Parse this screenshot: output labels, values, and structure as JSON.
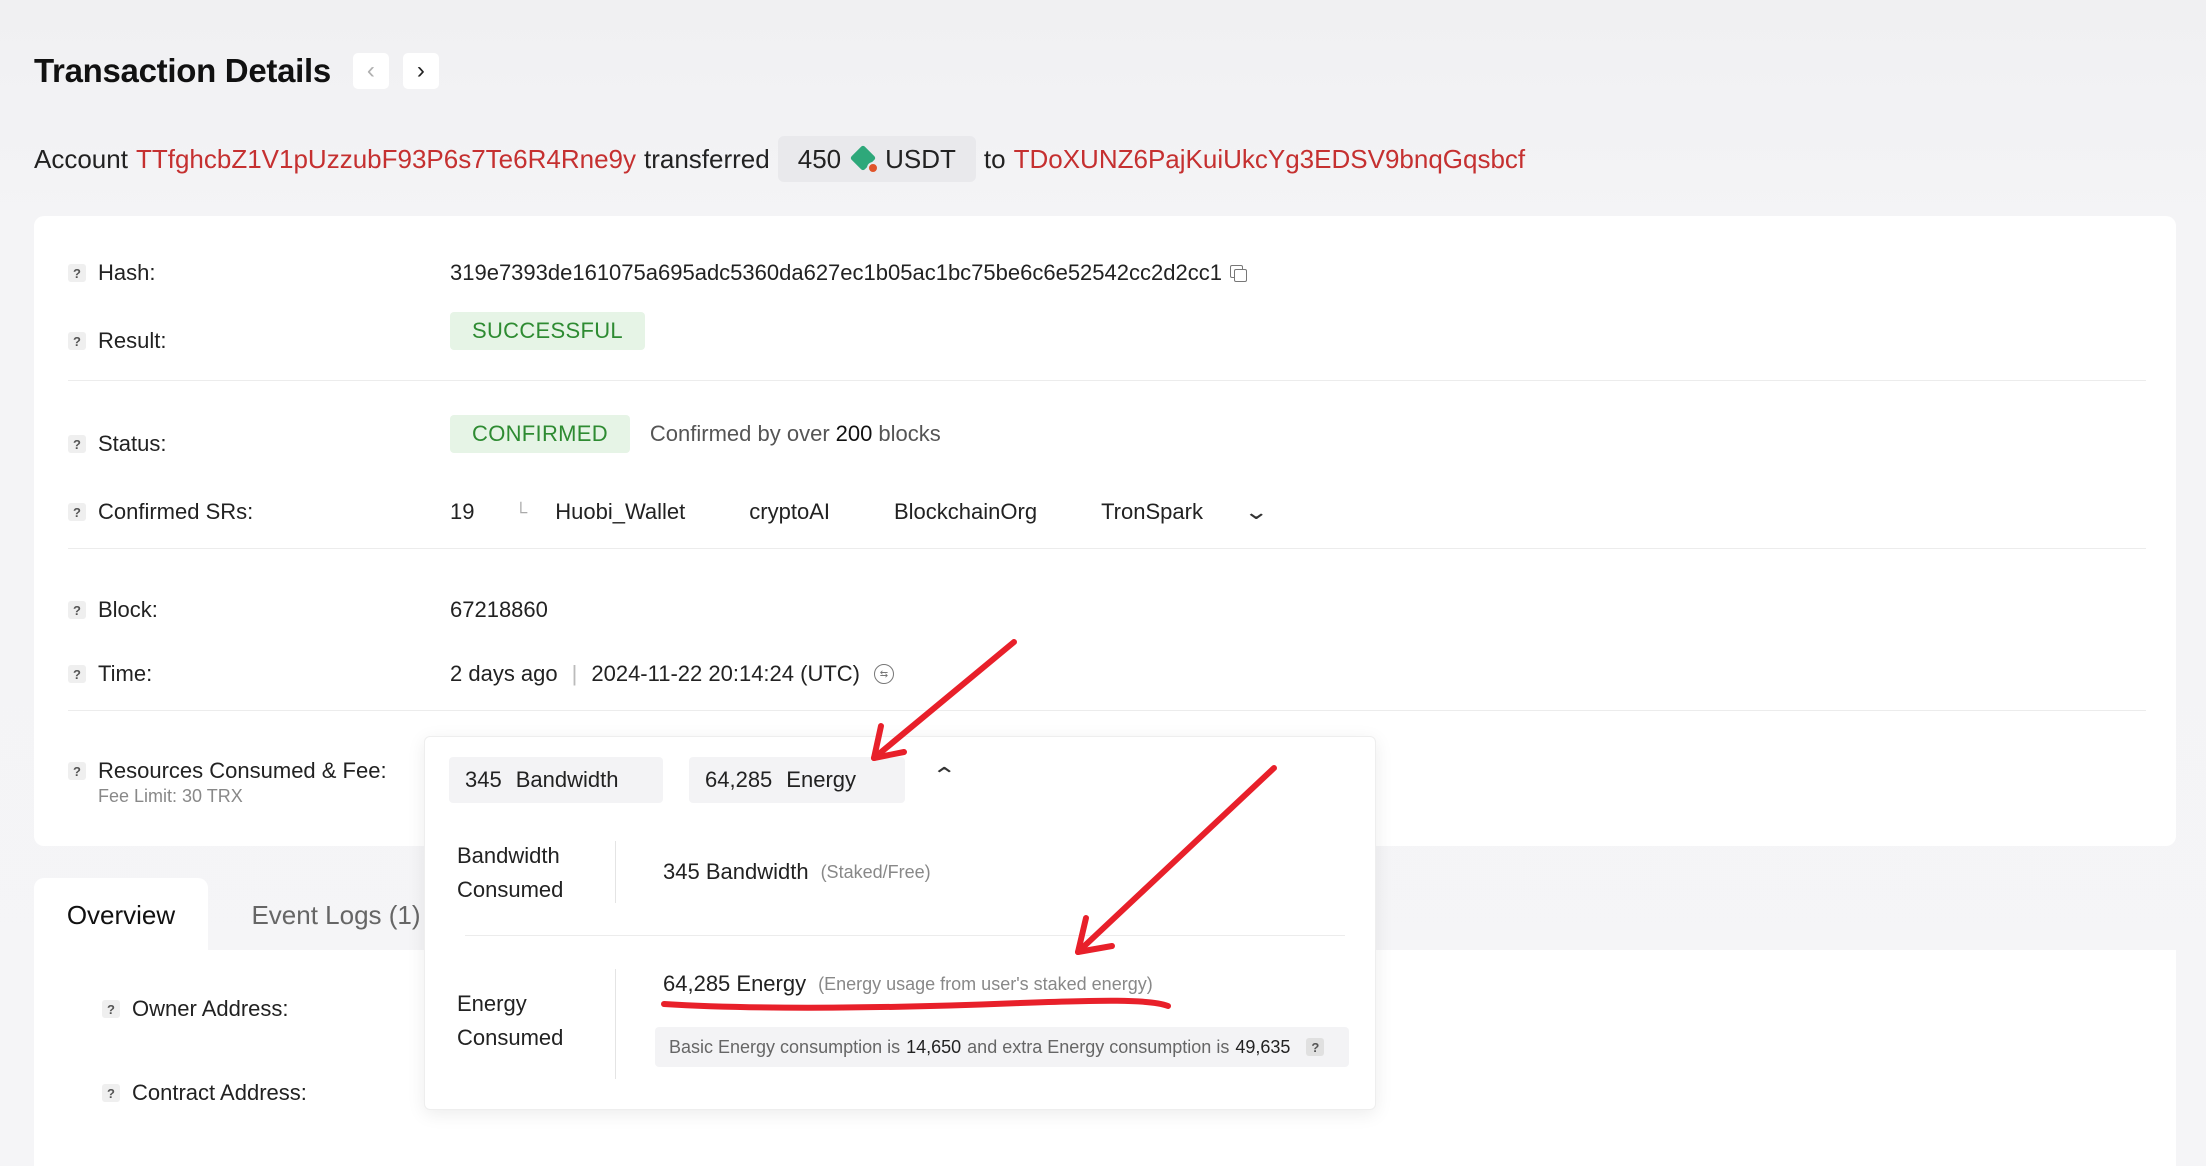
{
  "header": {
    "title": "Transaction Details",
    "prev": "‹",
    "next": "›"
  },
  "summary": {
    "prefix": "Account",
    "from": "TTfghcbZ1V1pUzzubF93P6s7Te6R4Rne9y",
    "verb": "transferred",
    "amount": "450",
    "token": "USDT",
    "to_word": "to",
    "to": "TDoXUNZ6PajKuiUkcYg3EDSV9bnqGqsbcf"
  },
  "details": {
    "hash_label": "Hash:",
    "hash": "319e7393de161075a695adc5360da627ec1b05ac1bc75be6c6e52542cc2d2cc1",
    "result_label": "Result:",
    "result": "SUCCESSFUL",
    "status_label": "Status:",
    "status": "CONFIRMED",
    "status_note_pre": "Confirmed by over",
    "status_note_num": "200",
    "status_note_post": "blocks",
    "srs_label": "Confirmed SRs:",
    "srs_count": "19",
    "srs": [
      "Huobi_Wallet",
      "cryptoAI",
      "BlockchainOrg",
      "TronSpark"
    ],
    "block_label": "Block:",
    "block": "67218860",
    "time_label": "Time:",
    "time_ago": "2 days ago",
    "time_sep": "|",
    "time_utc": "2024-11-22 20:14:24 (UTC)",
    "resources_label": "Resources Consumed & Fee:",
    "fee_limit": "Fee Limit: 30 TRX"
  },
  "resources": {
    "bandwidth_num": "345",
    "bandwidth_word": "Bandwidth",
    "energy_num": "64,285",
    "energy_word": "Energy",
    "bw_label_1": "Bandwidth",
    "bw_label_2": "Consumed",
    "bw_value": "345 Bandwidth",
    "bw_sub": "(Staked/Free)",
    "en_label_1": "Energy",
    "en_label_2": "Consumed",
    "en_value": "64,285 Energy",
    "en_sub": "(Energy usage from user's staked energy)",
    "info_pre": "Basic Energy consumption is",
    "info_basic": "14,650",
    "info_mid": "and extra Energy consumption is",
    "info_extra": "49,635"
  },
  "tabs": {
    "overview": "Overview",
    "events": "Event Logs (1)"
  },
  "lower": {
    "owner_label": "Owner Address:",
    "contract_label": "Contract Address:"
  },
  "qmark": "?",
  "colors": {
    "address": "#c53030",
    "success": "#2e8b32",
    "annotation": "#e8202a"
  }
}
